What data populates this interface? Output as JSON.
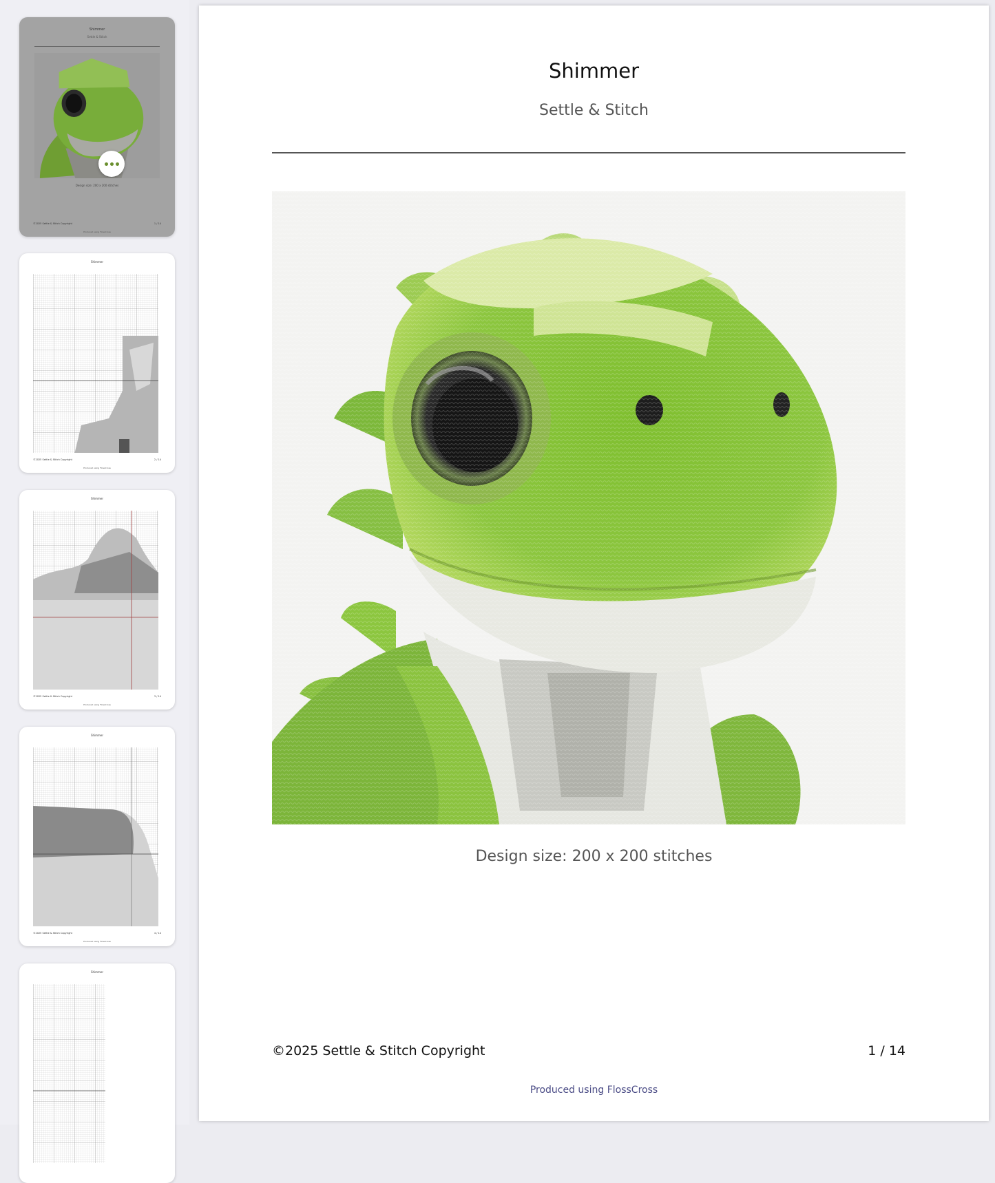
{
  "document": {
    "title": "Shimmer",
    "subtitle": "Settle & Stitch",
    "design_size": "Design size: 200 x 200 stitches",
    "copyright": "©2025 Settle & Stitch Copyright",
    "page_number": "1 / 14",
    "produced_prefix": "Produced using ",
    "produced_link": "FlossCross"
  },
  "thumbnails": [
    {
      "title": "Shimmer",
      "subtitle": "Settle & Stitch",
      "size": "Design size: 200 x 200 stitches",
      "copyright": "©2025 Settle & Stitch Copyright",
      "page": "1 / 14",
      "produced": "Produced using FlossCross"
    },
    {
      "title": "Shimmer",
      "copyright": "©2025 Settle & Stitch Copyright",
      "page": "2 / 14",
      "produced": "Produced using FlossCross"
    },
    {
      "title": "Shimmer",
      "copyright": "©2025 Settle & Stitch Copyright",
      "page": "3 / 14",
      "produced": "Produced using FlossCross"
    },
    {
      "title": "Shimmer",
      "copyright": "©2025 Settle & Stitch Copyright",
      "page": "4 / 14",
      "produced": "Produced using FlossCross"
    },
    {
      "title": "Shimmer"
    }
  ],
  "colors": {
    "link": "#4b4c86",
    "dino_green": "#8cc63f",
    "dino_light": "#e5f0c0",
    "belly": "#e8e9e2"
  },
  "icons": {
    "more": "more-horizontal-icon"
  }
}
